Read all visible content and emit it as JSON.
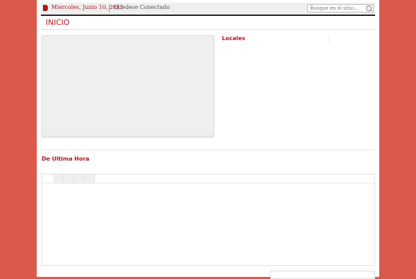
{
  "topbar": {
    "date": "Miercoles, Junio 10, 2015",
    "connected": "Quedese Conectado",
    "search_placeholder": "Busque en el sitio..."
  },
  "nav": {
    "items": [
      {
        "label": "INICIO"
      }
    ]
  },
  "sections": {
    "locales": "Locales",
    "breaking": "De Ultima Hora"
  },
  "tabs": {
    "count": 4
  },
  "colors": {
    "background": "#d95a4d",
    "accent": "#b4121b"
  },
  "icons": [
    "calendar-icon",
    "search-icon"
  ]
}
